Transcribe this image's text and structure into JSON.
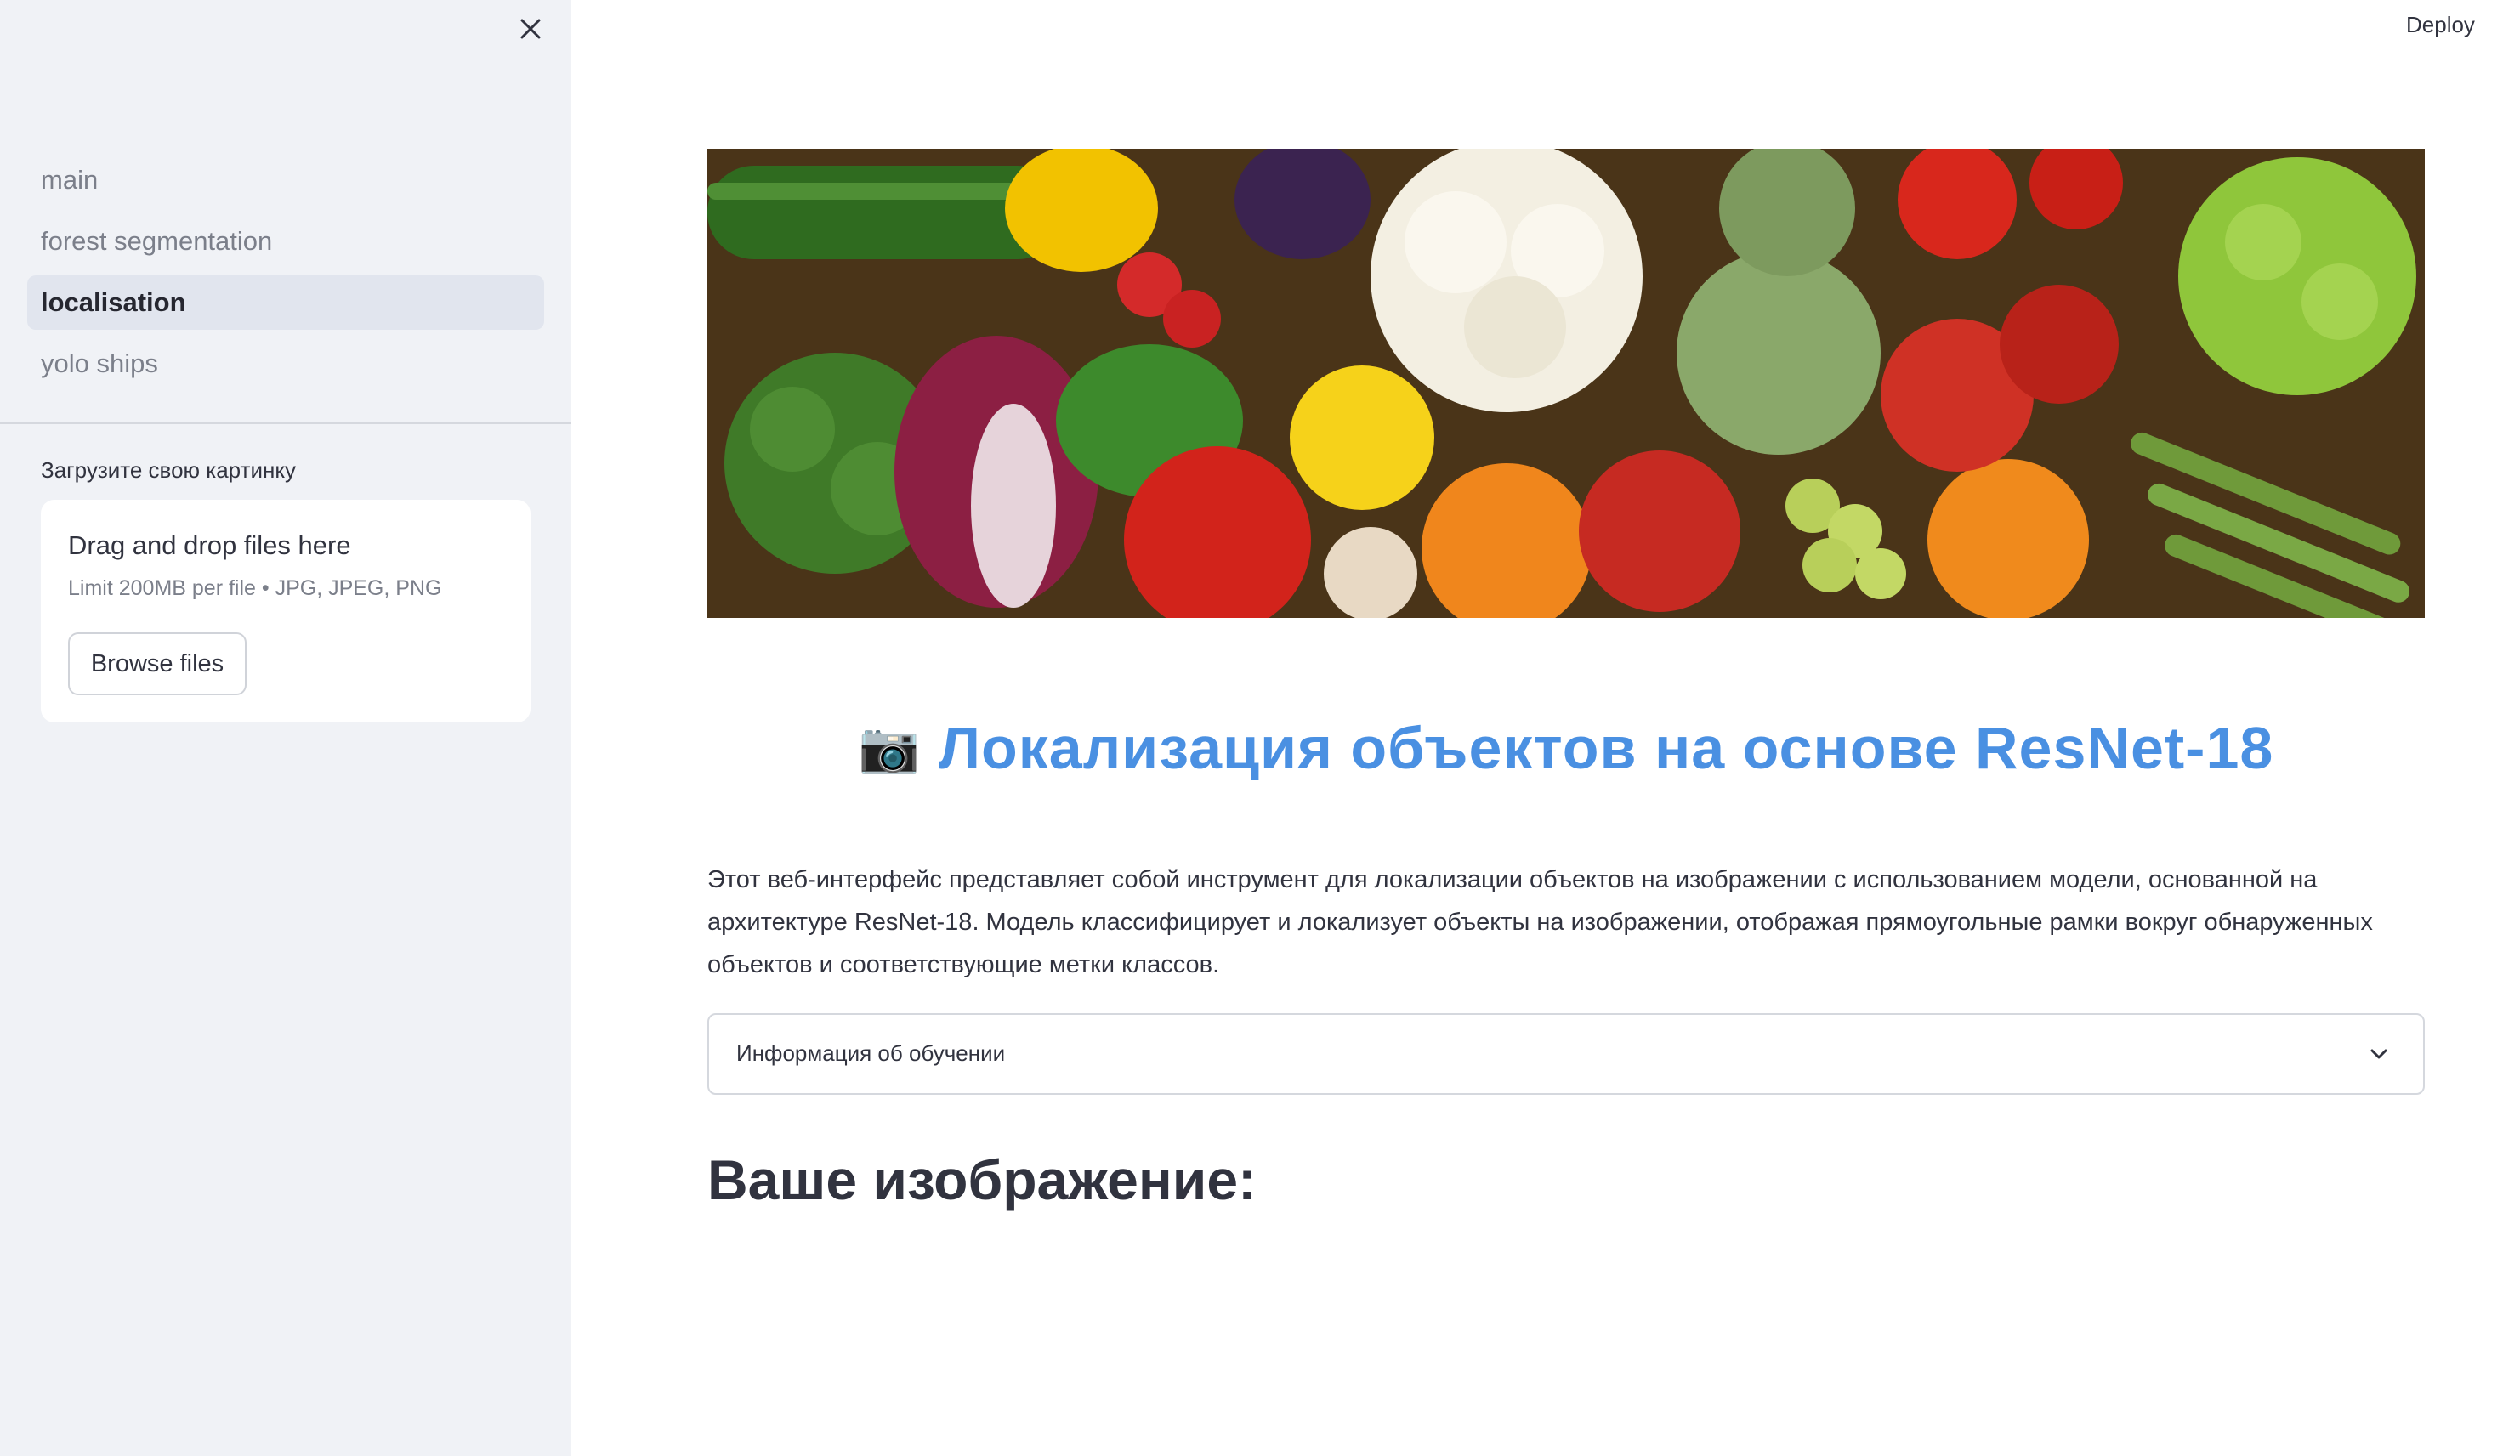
{
  "sidebar": {
    "close_icon": "close-icon",
    "items": [
      {
        "label": "main",
        "active": false
      },
      {
        "label": "forest segmentation",
        "active": false
      },
      {
        "label": "localisation",
        "active": true
      },
      {
        "label": "yolo ships",
        "active": false
      }
    ],
    "upload": {
      "label": "Загрузите свою картинку",
      "drop_title": "Drag and drop files here",
      "limit_text": "Limit 200MB per file • JPG, JPEG, PNG",
      "browse_label": "Browse files"
    }
  },
  "header": {
    "deploy_label": "Deploy"
  },
  "main": {
    "banner_icon": "vegetables-photo",
    "title_emoji": "📷",
    "title": "Локализация объектов на основе ResNet-18",
    "description": "Этот веб-интерфейс представляет собой инструмент для локализации объектов на изображении с использованием модели, основанной на архитектуре ResNet-18. Модель классифицирует и локализует объекты на изображении, отображая прямоугольные рамки вокруг обнаруженных объектов и соответствующие метки классов.",
    "expander_label": "Информация об обучении",
    "subheading": "Ваше изображение:"
  },
  "colors": {
    "title": "#4a90e2",
    "sidebar_bg": "#f0f2f6",
    "active_item_bg": "#e1e5ee"
  }
}
